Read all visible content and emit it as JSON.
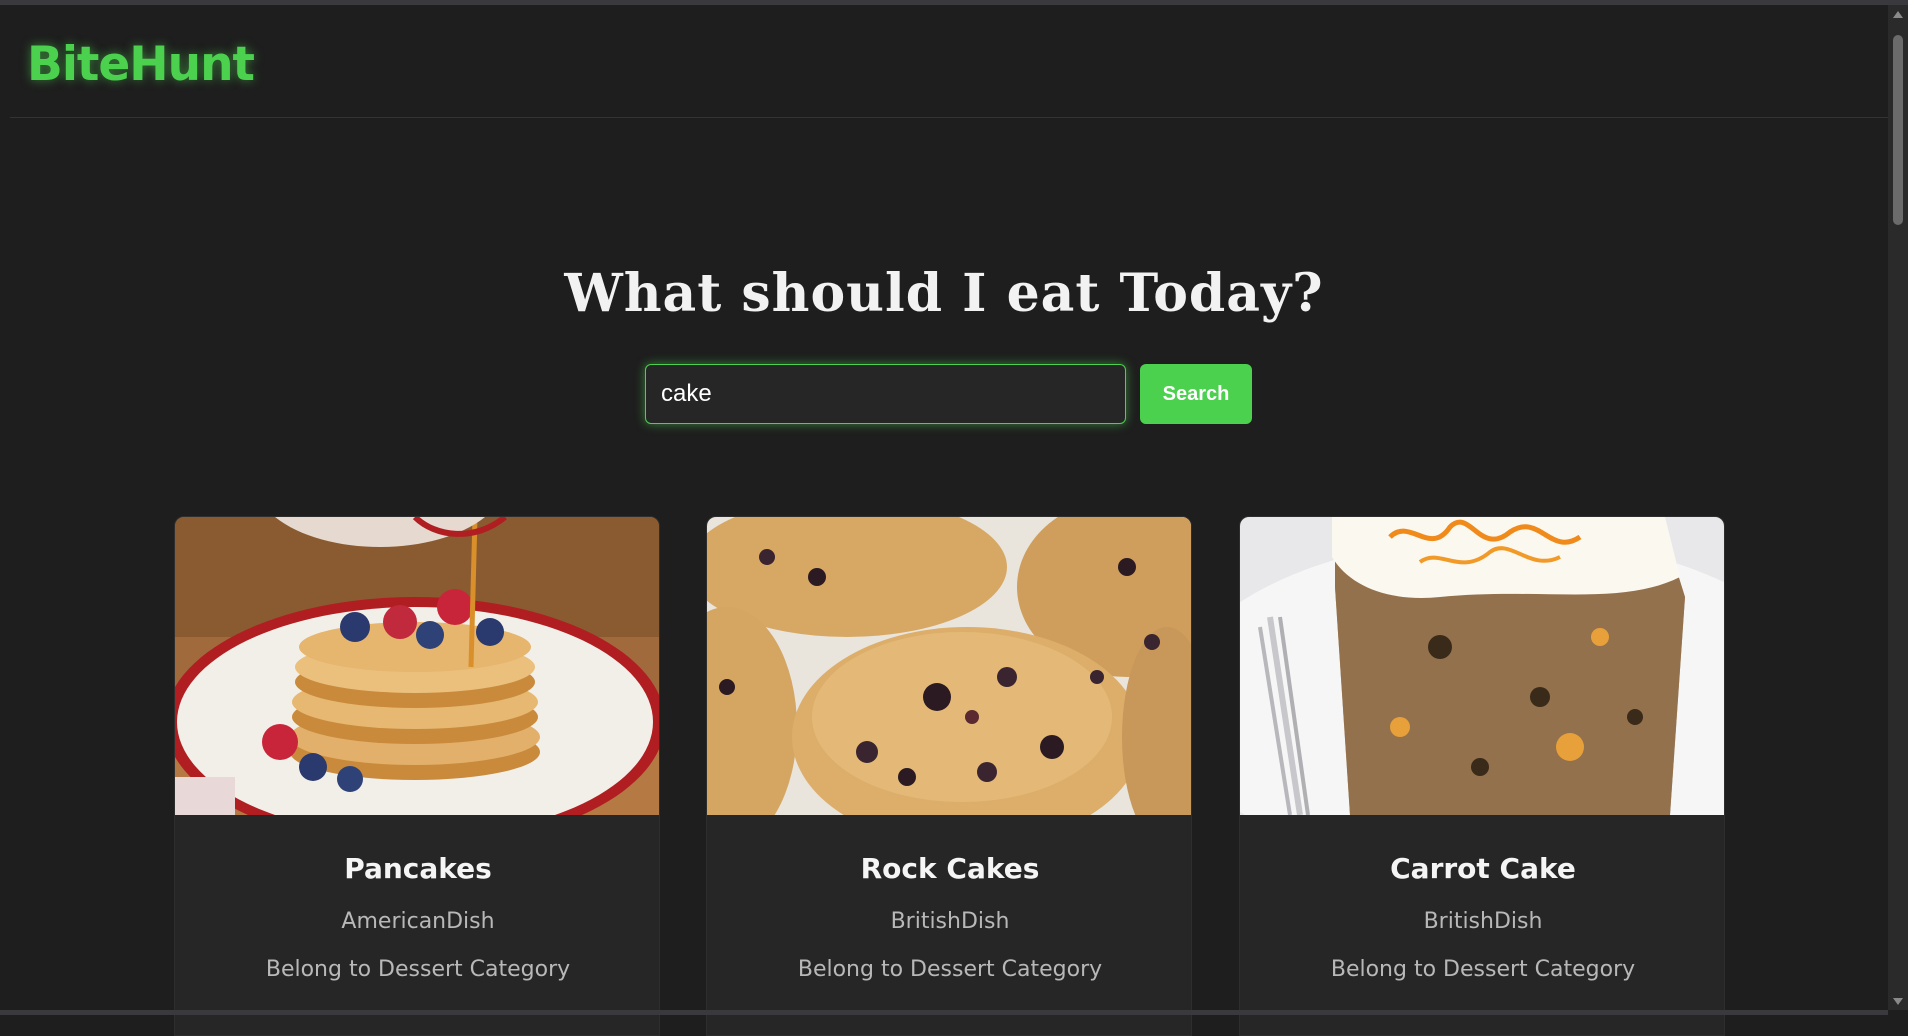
{
  "brand": {
    "name": "BiteHunt"
  },
  "hero": {
    "title": "What should I eat Today?"
  },
  "search": {
    "value": "cake",
    "button_label": "Search"
  },
  "meals": [
    {
      "name": "Pancakes",
      "area": "AmericanDish",
      "category": "Belong to Dessert Category",
      "image": "pancakes-photo"
    },
    {
      "name": "Rock Cakes",
      "area": "BritishDish",
      "category": "Belong to Dessert Category",
      "image": "rock-cakes-photo"
    },
    {
      "name": "Carrot Cake",
      "area": "BritishDish",
      "category": "Belong to Dessert Category",
      "image": "carrot-cake-photo"
    }
  ],
  "colors": {
    "accent": "#4cd14f",
    "background": "#1e1e1e",
    "card": "#262626"
  }
}
